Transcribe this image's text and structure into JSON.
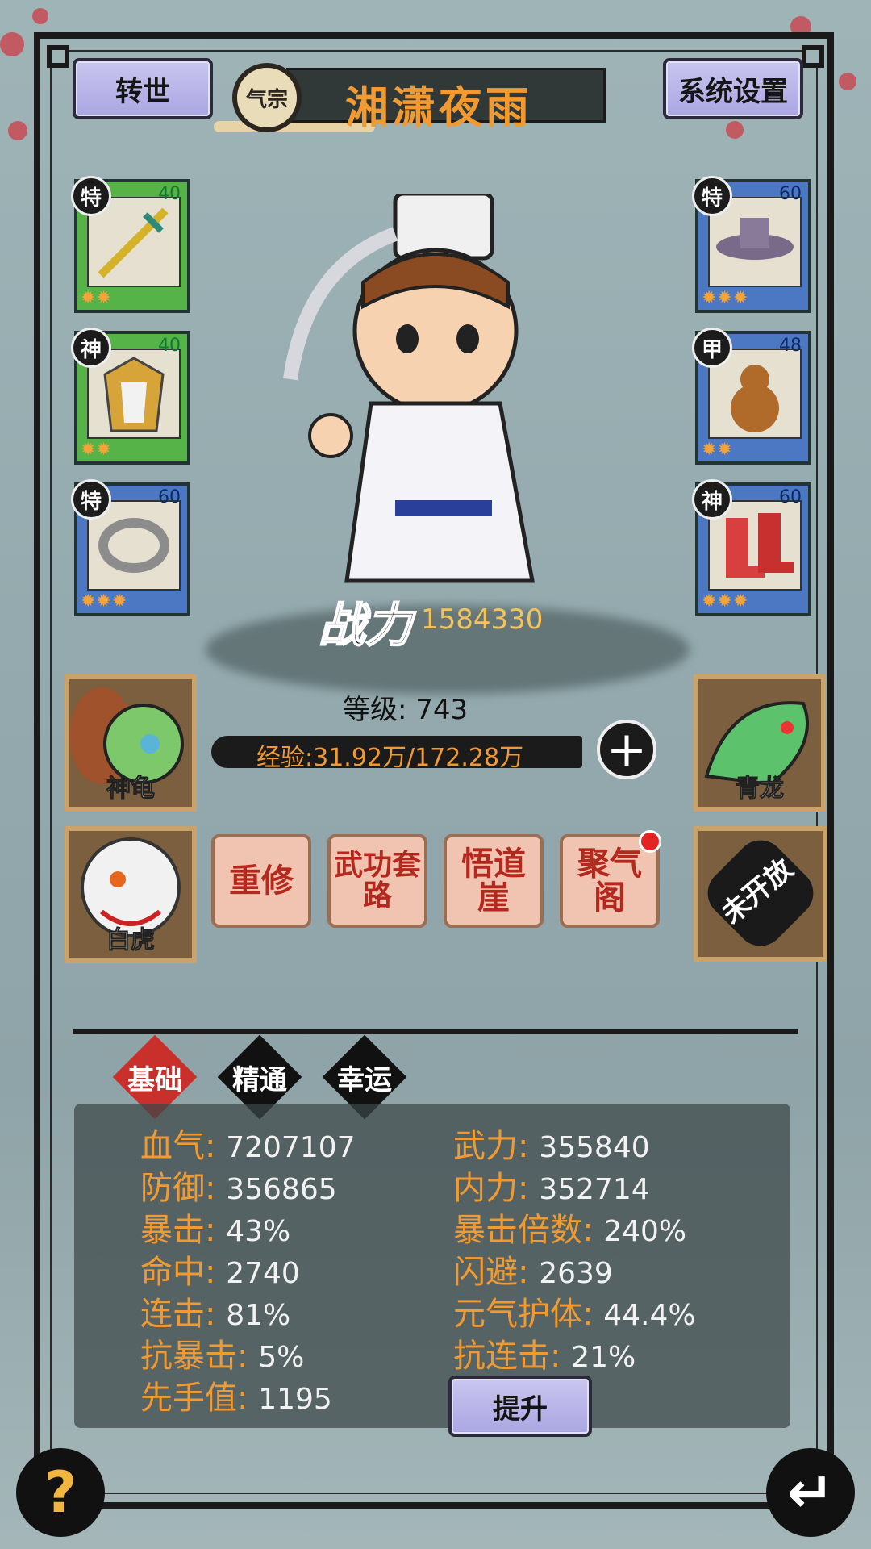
{
  "header": {
    "reincarnate_label": "转世",
    "sect_label": "气宗",
    "player_name": "湘潇夜雨",
    "settings_label": "系统设置"
  },
  "equipment": {
    "left": [
      {
        "tag": "特",
        "level": "40",
        "stars": "✹✹",
        "item": "sword"
      },
      {
        "tag": "神",
        "level": "40",
        "stars": "✹✹",
        "item": "armor"
      },
      {
        "tag": "特",
        "level": "60",
        "stars": "✹✹✹",
        "item": "ring"
      }
    ],
    "right": [
      {
        "tag": "特",
        "level": "60",
        "stars": "✹✹✹",
        "item": "hat"
      },
      {
        "tag": "甲",
        "level": "48",
        "stars": "✹✹",
        "item": "gourd"
      },
      {
        "tag": "神",
        "level": "60",
        "stars": "✹✹✹",
        "item": "boots"
      }
    ]
  },
  "hero": {
    "power_label": "战力",
    "power_value": "1584330",
    "level_text": "等级: 743",
    "exp_text": "经验:31.92万/172.28万"
  },
  "beasts": {
    "turtle": "神龟",
    "dragon": "青龙",
    "tiger": "白虎",
    "locked": "未开放"
  },
  "functions": [
    {
      "label": "重修"
    },
    {
      "label": "武功套路"
    },
    {
      "label": "悟道崖"
    },
    {
      "label": "聚气阁"
    }
  ],
  "tabs": [
    "基础",
    "精通",
    "幸运"
  ],
  "stats_left": [
    {
      "k": "血气: ",
      "v": "7207107"
    },
    {
      "k": "防御: ",
      "v": "356865"
    },
    {
      "k": "暴击: ",
      "v": "43%"
    },
    {
      "k": "命中: ",
      "v": "2740"
    },
    {
      "k": "连击: ",
      "v": "81%"
    },
    {
      "k": "抗暴击: ",
      "v": "5%"
    },
    {
      "k": "先手值: ",
      "v": "1195"
    }
  ],
  "stats_right": [
    {
      "k": "武力: ",
      "v": "355840"
    },
    {
      "k": "内力: ",
      "v": "352714"
    },
    {
      "k": "暴击倍数: ",
      "v": "240%"
    },
    {
      "k": "闪避: ",
      "v": "2639"
    },
    {
      "k": "元气护体: ",
      "v": "44.4%"
    },
    {
      "k": "抗连击: ",
      "v": "21%"
    }
  ],
  "upgrade_label": "提升",
  "help_label": "?",
  "back_label": "↵"
}
